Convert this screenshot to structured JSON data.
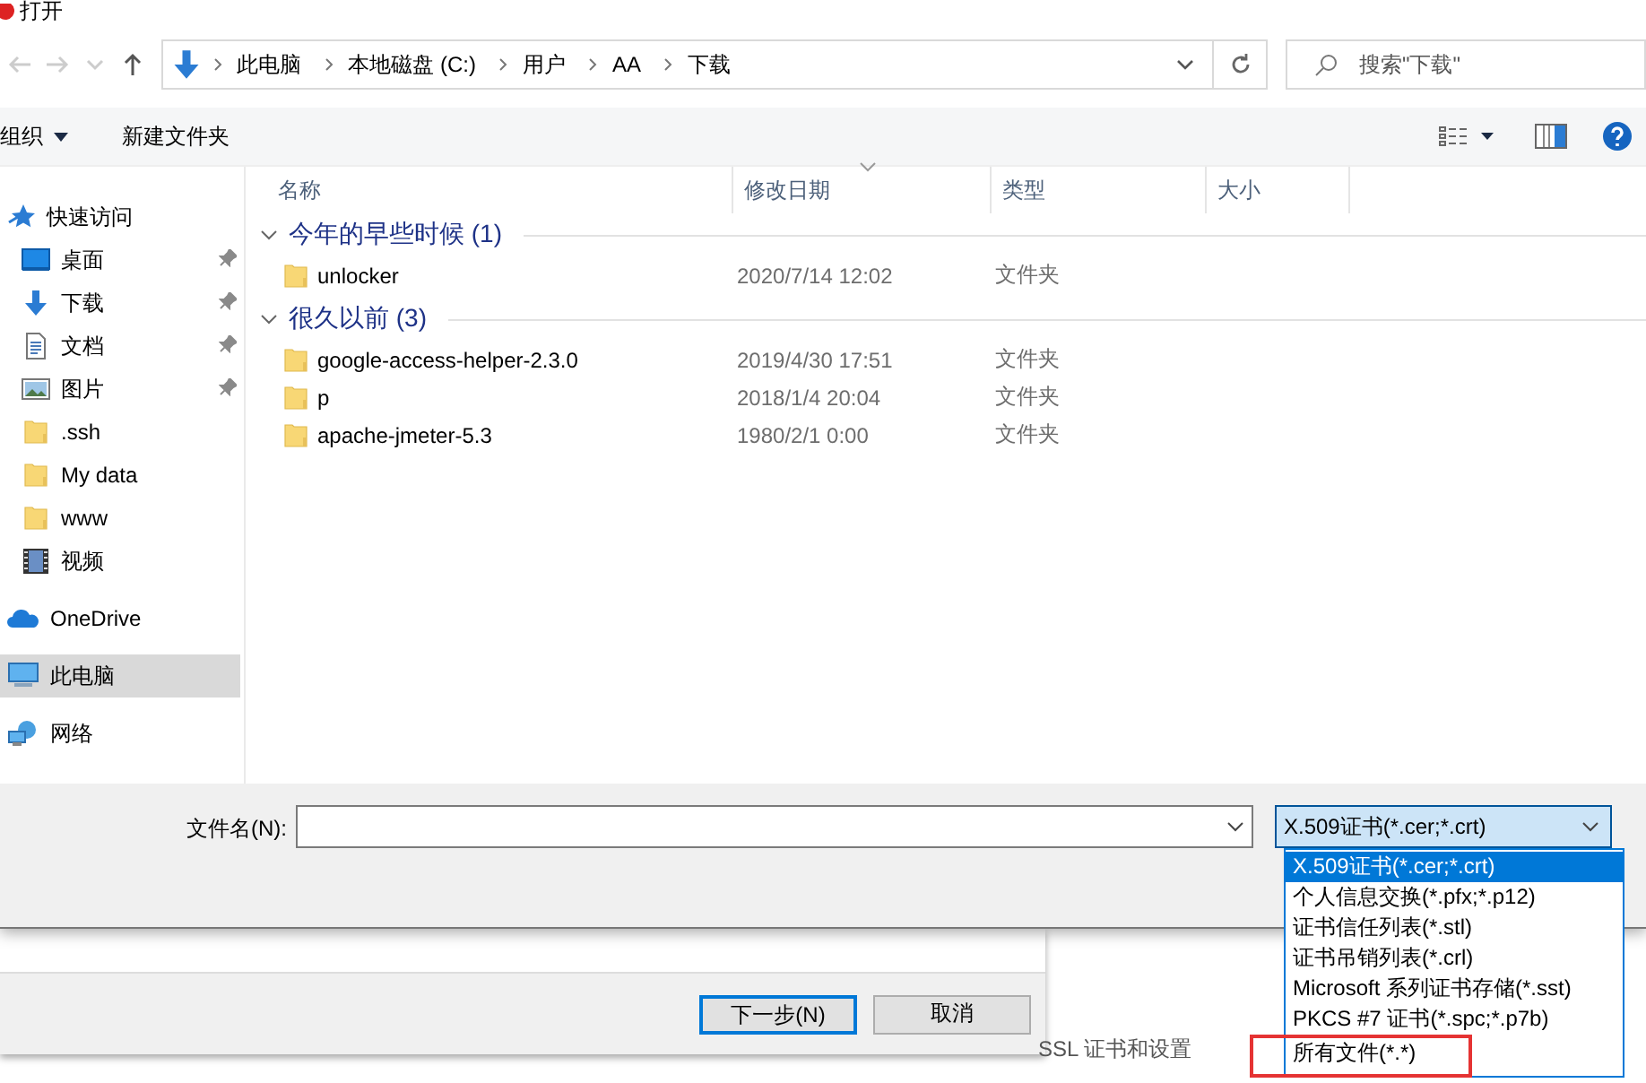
{
  "window": {
    "title": "打开"
  },
  "nav": {
    "path": [
      "此电脑",
      "本地磁盘 (C:)",
      "用户",
      "AA",
      "下载"
    ],
    "search": {
      "placeholder": "搜索\"下载\""
    }
  },
  "toolbar": {
    "organize": "组织",
    "new_folder": "新建文件夹"
  },
  "sidebar": {
    "items": [
      {
        "label": "快速访问",
        "kind": "header",
        "pinned": false,
        "selected": false
      },
      {
        "label": "桌面",
        "kind": "sub",
        "pinned": true,
        "selected": false
      },
      {
        "label": "下载",
        "kind": "sub",
        "pinned": true,
        "selected": false
      },
      {
        "label": "文档",
        "kind": "sub",
        "pinned": true,
        "selected": false
      },
      {
        "label": "图片",
        "kind": "sub",
        "pinned": true,
        "selected": false
      },
      {
        "label": ".ssh",
        "kind": "sub",
        "pinned": false,
        "selected": false
      },
      {
        "label": "My data",
        "kind": "sub",
        "pinned": false,
        "selected": false
      },
      {
        "label": "www",
        "kind": "sub",
        "pinned": false,
        "selected": false
      },
      {
        "label": "视频",
        "kind": "sub",
        "pinned": false,
        "selected": false
      },
      {
        "label": "OneDrive",
        "kind": "header",
        "pinned": false,
        "selected": false
      },
      {
        "label": "此电脑",
        "kind": "header",
        "pinned": false,
        "selected": true
      },
      {
        "label": "网络",
        "kind": "header",
        "pinned": false,
        "selected": false
      }
    ]
  },
  "table": {
    "columns": [
      "名称",
      "修改日期",
      "类型",
      "大小"
    ],
    "groups": [
      {
        "title": "今年的早些时候 (1)",
        "expanded": true,
        "rows": [
          {
            "name": "unlocker",
            "date": "2020/7/14 12:02",
            "type": "文件夹"
          }
        ]
      },
      {
        "title": "很久以前 (3)",
        "expanded": true,
        "rows": [
          {
            "name": "google-access-helper-2.3.0",
            "date": "2019/4/30 17:51",
            "type": "文件夹"
          },
          {
            "name": "p",
            "date": "2018/1/4 20:04",
            "type": "文件夹"
          },
          {
            "name": "apache-jmeter-5.3",
            "date": "1980/2/1 0:00",
            "type": "文件夹"
          }
        ]
      }
    ]
  },
  "filename": {
    "label": "文件名(N):"
  },
  "filter": {
    "value": "X.509证书(*.cer;*.crt)",
    "expanded": true,
    "options": [
      {
        "label": "X.509证书(*.cer;*.crt)",
        "selected": true,
        "annotated": false
      },
      {
        "label": "个人信息交换(*.pfx;*.p12)",
        "selected": false,
        "annotated": false
      },
      {
        "label": "证书信任列表(*.stl)",
        "selected": false,
        "annotated": false
      },
      {
        "label": "证书吊销列表(*.crl)",
        "selected": false,
        "annotated": false
      },
      {
        "label": "Microsoft 系列证书存储(*.sst)",
        "selected": false,
        "annotated": false
      },
      {
        "label": "PKCS #7 证书(*.spc;*.p7b)",
        "selected": false,
        "annotated": false
      },
      {
        "label": "所有文件(*.*)",
        "selected": false,
        "annotated": true
      }
    ]
  },
  "wizard": {
    "buttons": [
      {
        "label": "下一步(N)",
        "default": true
      },
      {
        "label": "取消",
        "default": false
      }
    ],
    "text": "SSL 证书和设置"
  }
}
